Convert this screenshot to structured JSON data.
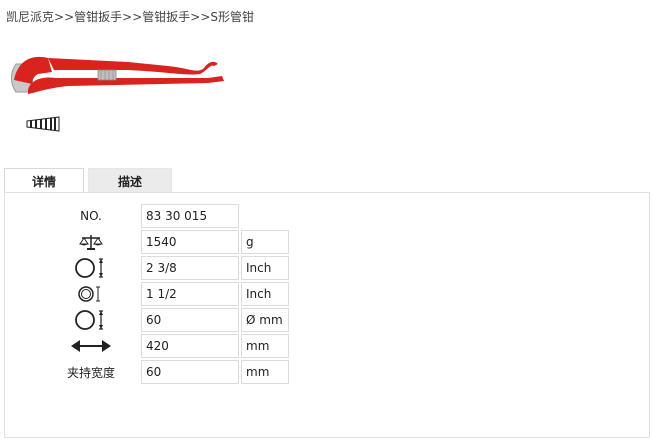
{
  "breadcrumb": {
    "items": [
      "凯尼派克",
      "管钳扳手",
      "管钳扳手",
      "S形管钳"
    ],
    "separator": ">>"
  },
  "tabs": [
    {
      "label": "详情",
      "active": true
    },
    {
      "label": "描述",
      "active": false
    }
  ],
  "specs": [
    {
      "label": "NO.",
      "icon": "",
      "value": "83 30 015",
      "unit": ""
    },
    {
      "label": "",
      "icon": "weight-scale-icon",
      "value": "1540",
      "unit": "g"
    },
    {
      "label": "",
      "icon": "pipe-size-icon",
      "value": "2 3/8",
      "unit": "Inch"
    },
    {
      "label": "",
      "icon": "tube-capacity-icon",
      "value": "1 1/2",
      "unit": "Inch"
    },
    {
      "label": "",
      "icon": "diameter-icon",
      "value": "60",
      "unit": "Ø mm"
    },
    {
      "label": "",
      "icon": "length-arrows-icon",
      "value": "420",
      "unit": "mm"
    },
    {
      "label": "夹持宽度",
      "icon": "",
      "value": "60",
      "unit": "mm"
    }
  ],
  "colors": {
    "tool_red": "#d9231f",
    "jaw_silver": "#c8c8c8",
    "tab_inactive_bg": "#ebebeb"
  }
}
